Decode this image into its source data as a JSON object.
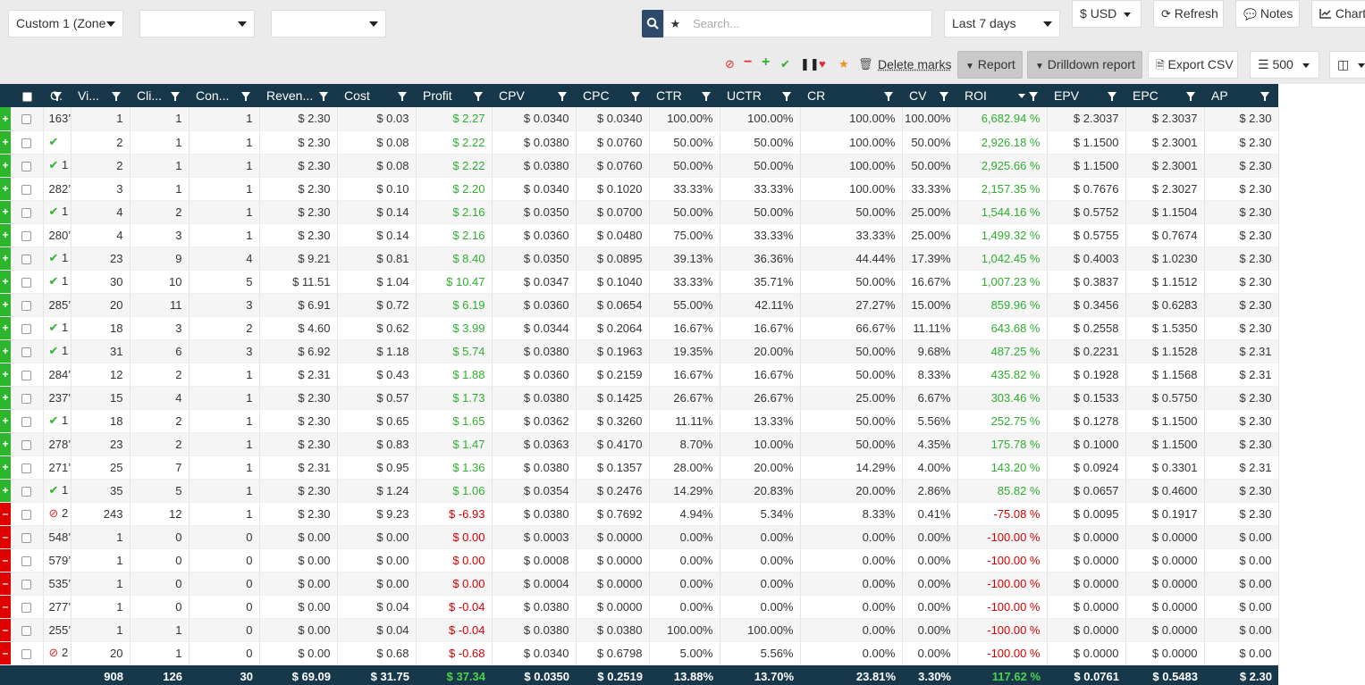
{
  "toolbar": {
    "group1": "Custom 1 (Zone",
    "group2": "",
    "group3": "",
    "search_placeholder": "Search...",
    "date_range": "Last 7 days",
    "currency": "USD",
    "refresh": "Refresh",
    "notes": "Notes",
    "chart": "Chart",
    "delete_marks": "Delete marks",
    "report": "Report",
    "drilldown": "Drilldown report",
    "export_csv": "Export CSV",
    "page_size": "500"
  },
  "columns": [
    "C.",
    "Vi...",
    "Cli...",
    "Con...",
    "Reven...",
    "Cost",
    "Profit",
    "CPV",
    "CPC",
    "CTR",
    "UCTR",
    "CR",
    "CV",
    "ROI",
    "EPV",
    "EPC",
    "AP"
  ],
  "rows": [
    {
      "mark": "+",
      "id": "163’",
      "ok": false,
      "ban": false,
      "v": [
        "1",
        "1",
        "1",
        "$ 2.30",
        "$ 0.03",
        "$ 2.27",
        "$ 0.0340",
        "$ 0.0340",
        "100.00%",
        "100.00%",
        "100.00%",
        "100.00%",
        "6,682.94 %",
        "$ 2.3037",
        "$ 2.3037",
        "$ 2.30"
      ]
    },
    {
      "mark": "+",
      "id": "",
      "ok": true,
      "ban": false,
      "v": [
        "2",
        "1",
        "1",
        "$ 2.30",
        "$ 0.08",
        "$ 2.22",
        "$ 0.0380",
        "$ 0.0760",
        "50.00%",
        "50.00%",
        "100.00%",
        "50.00%",
        "2,926.18 %",
        "$ 1.1500",
        "$ 2.3001",
        "$ 2.30"
      ]
    },
    {
      "mark": "+",
      "id": "1",
      "ok": true,
      "ban": false,
      "v": [
        "2",
        "1",
        "1",
        "$ 2.30",
        "$ 0.08",
        "$ 2.22",
        "$ 0.0380",
        "$ 0.0760",
        "50.00%",
        "50.00%",
        "100.00%",
        "50.00%",
        "2,925.66 %",
        "$ 1.1500",
        "$ 2.3001",
        "$ 2.30"
      ]
    },
    {
      "mark": "+",
      "id": "282’",
      "ok": false,
      "ban": false,
      "v": [
        "3",
        "1",
        "1",
        "$ 2.30",
        "$ 0.10",
        "$ 2.20",
        "$ 0.0340",
        "$ 0.1020",
        "33.33%",
        "33.33%",
        "100.00%",
        "33.33%",
        "2,157.35 %",
        "$ 0.7676",
        "$ 2.3027",
        "$ 2.30"
      ]
    },
    {
      "mark": "+",
      "id": "1",
      "ok": true,
      "ban": false,
      "v": [
        "4",
        "2",
        "1",
        "$ 2.30",
        "$ 0.14",
        "$ 2.16",
        "$ 0.0350",
        "$ 0.0700",
        "50.00%",
        "50.00%",
        "50.00%",
        "25.00%",
        "1,544.16 %",
        "$ 0.5752",
        "$ 1.1504",
        "$ 2.30"
      ]
    },
    {
      "mark": "+",
      "id": "280’",
      "ok": false,
      "ban": false,
      "v": [
        "4",
        "3",
        "1",
        "$ 2.30",
        "$ 0.14",
        "$ 2.16",
        "$ 0.0360",
        "$ 0.0480",
        "75.00%",
        "33.33%",
        "33.33%",
        "25.00%",
        "1,499.32 %",
        "$ 0.5755",
        "$ 0.7674",
        "$ 2.30"
      ]
    },
    {
      "mark": "+",
      "id": "1",
      "ok": true,
      "ban": false,
      "v": [
        "23",
        "9",
        "4",
        "$ 9.21",
        "$ 0.81",
        "$ 8.40",
        "$ 0.0350",
        "$ 0.0895",
        "39.13%",
        "36.36%",
        "44.44%",
        "17.39%",
        "1,042.45 %",
        "$ 0.4003",
        "$ 1.0230",
        "$ 2.30"
      ]
    },
    {
      "mark": "+",
      "id": "1",
      "ok": true,
      "ban": false,
      "v": [
        "30",
        "10",
        "5",
        "$ 11.51",
        "$ 1.04",
        "$ 10.47",
        "$ 0.0347",
        "$ 0.1040",
        "33.33%",
        "35.71%",
        "50.00%",
        "16.67%",
        "1,007.23 %",
        "$ 0.3837",
        "$ 1.1512",
        "$ 2.30"
      ]
    },
    {
      "mark": "+",
      "id": "285’",
      "ok": false,
      "ban": false,
      "v": [
        "20",
        "11",
        "3",
        "$ 6.91",
        "$ 0.72",
        "$ 6.19",
        "$ 0.0360",
        "$ 0.0654",
        "55.00%",
        "42.11%",
        "27.27%",
        "15.00%",
        "859.96 %",
        "$ 0.3456",
        "$ 0.6283",
        "$ 2.30"
      ]
    },
    {
      "mark": "+",
      "id": "1",
      "ok": true,
      "ban": false,
      "v": [
        "18",
        "3",
        "2",
        "$ 4.60",
        "$ 0.62",
        "$ 3.99",
        "$ 0.0344",
        "$ 0.2064",
        "16.67%",
        "16.67%",
        "66.67%",
        "11.11%",
        "643.68 %",
        "$ 0.2558",
        "$ 1.5350",
        "$ 2.30"
      ]
    },
    {
      "mark": "+",
      "id": "1",
      "ok": true,
      "ban": false,
      "v": [
        "31",
        "6",
        "3",
        "$ 6.92",
        "$ 1.18",
        "$ 5.74",
        "$ 0.0380",
        "$ 0.1963",
        "19.35%",
        "20.00%",
        "50.00%",
        "9.68%",
        "487.25 %",
        "$ 0.2231",
        "$ 1.1528",
        "$ 2.31"
      ]
    },
    {
      "mark": "+",
      "id": "284’",
      "ok": false,
      "ban": false,
      "v": [
        "12",
        "2",
        "1",
        "$ 2.31",
        "$ 0.43",
        "$ 1.88",
        "$ 0.0360",
        "$ 0.2159",
        "16.67%",
        "16.67%",
        "50.00%",
        "8.33%",
        "435.82 %",
        "$ 0.1928",
        "$ 1.1568",
        "$ 2.31"
      ]
    },
    {
      "mark": "+",
      "id": "237’",
      "ok": false,
      "ban": false,
      "v": [
        "15",
        "4",
        "1",
        "$ 2.30",
        "$ 0.57",
        "$ 1.73",
        "$ 0.0380",
        "$ 0.1425",
        "26.67%",
        "26.67%",
        "25.00%",
        "6.67%",
        "303.46 %",
        "$ 0.1533",
        "$ 0.5750",
        "$ 2.30"
      ]
    },
    {
      "mark": "+",
      "id": "1",
      "ok": true,
      "ban": false,
      "v": [
        "18",
        "2",
        "1",
        "$ 2.30",
        "$ 0.65",
        "$ 1.65",
        "$ 0.0362",
        "$ 0.3260",
        "11.11%",
        "13.33%",
        "50.00%",
        "5.56%",
        "252.75 %",
        "$ 0.1278",
        "$ 1.1500",
        "$ 2.30"
      ]
    },
    {
      "mark": "+",
      "id": "278’",
      "ok": false,
      "ban": false,
      "v": [
        "23",
        "2",
        "1",
        "$ 2.30",
        "$ 0.83",
        "$ 1.47",
        "$ 0.0363",
        "$ 0.4170",
        "8.70%",
        "10.00%",
        "50.00%",
        "4.35%",
        "175.78 %",
        "$ 0.1000",
        "$ 1.1500",
        "$ 2.30"
      ]
    },
    {
      "mark": "+",
      "id": "271’",
      "ok": false,
      "ban": false,
      "v": [
        "25",
        "7",
        "1",
        "$ 2.31",
        "$ 0.95",
        "$ 1.36",
        "$ 0.0380",
        "$ 0.1357",
        "28.00%",
        "20.00%",
        "14.29%",
        "4.00%",
        "143.20 %",
        "$ 0.0924",
        "$ 0.3301",
        "$ 2.31"
      ]
    },
    {
      "mark": "+",
      "id": "1",
      "ok": true,
      "ban": false,
      "v": [
        "35",
        "5",
        "1",
        "$ 2.30",
        "$ 1.24",
        "$ 1.06",
        "$ 0.0354",
        "$ 0.2476",
        "14.29%",
        "20.83%",
        "20.00%",
        "2.86%",
        "85.82 %",
        "$ 0.0657",
        "$ 0.4600",
        "$ 2.30"
      ]
    },
    {
      "mark": "–",
      "id": "2",
      "ok": false,
      "ban": true,
      "v": [
        "243",
        "12",
        "1",
        "$ 2.30",
        "$ 9.23",
        "$ -6.93",
        "$ 0.0380",
        "$ 0.7692",
        "4.94%",
        "5.34%",
        "8.33%",
        "0.41%",
        "-75.08 %",
        "$ 0.0095",
        "$ 0.1917",
        "$ 2.30"
      ]
    },
    {
      "mark": "–",
      "id": "548’",
      "ok": false,
      "ban": false,
      "v": [
        "1",
        "0",
        "0",
        "$ 0.00",
        "$ 0.00",
        "$ 0.00",
        "$ 0.0003",
        "$ 0.0000",
        "0.00%",
        "0.00%",
        "0.00%",
        "0.00%",
        "-100.00 %",
        "$ 0.0000",
        "$ 0.0000",
        "$ 0.00"
      ]
    },
    {
      "mark": "–",
      "id": "579’",
      "ok": false,
      "ban": false,
      "v": [
        "1",
        "0",
        "0",
        "$ 0.00",
        "$ 0.00",
        "$ 0.00",
        "$ 0.0008",
        "$ 0.0000",
        "0.00%",
        "0.00%",
        "0.00%",
        "0.00%",
        "-100.00 %",
        "$ 0.0000",
        "$ 0.0000",
        "$ 0.00"
      ]
    },
    {
      "mark": "–",
      "id": "535’",
      "ok": false,
      "ban": false,
      "v": [
        "1",
        "0",
        "0",
        "$ 0.00",
        "$ 0.00",
        "$ 0.00",
        "$ 0.0004",
        "$ 0.0000",
        "0.00%",
        "0.00%",
        "0.00%",
        "0.00%",
        "-100.00 %",
        "$ 0.0000",
        "$ 0.0000",
        "$ 0.00"
      ]
    },
    {
      "mark": "–",
      "id": "277’",
      "ok": false,
      "ban": false,
      "v": [
        "1",
        "0",
        "0",
        "$ 0.00",
        "$ 0.04",
        "$ -0.04",
        "$ 0.0380",
        "$ 0.0000",
        "0.00%",
        "0.00%",
        "0.00%",
        "0.00%",
        "-100.00 %",
        "$ 0.0000",
        "$ 0.0000",
        "$ 0.00"
      ]
    },
    {
      "mark": "–",
      "id": "255’",
      "ok": false,
      "ban": false,
      "v": [
        "1",
        "1",
        "0",
        "$ 0.00",
        "$ 0.04",
        "$ -0.04",
        "$ 0.0380",
        "$ 0.0380",
        "100.00%",
        "100.00%",
        "0.00%",
        "0.00%",
        "-100.00 %",
        "$ 0.0000",
        "$ 0.0000",
        "$ 0.00"
      ]
    },
    {
      "mark": "–",
      "id": "2",
      "ok": false,
      "ban": true,
      "v": [
        "20",
        "1",
        "0",
        "$ 0.00",
        "$ 0.68",
        "$ -0.68",
        "$ 0.0340",
        "$ 0.6798",
        "5.00%",
        "5.56%",
        "0.00%",
        "0.00%",
        "-100.00 %",
        "$ 0.0000",
        "$ 0.0000",
        "$ 0.00"
      ]
    }
  ],
  "totals": [
    "908",
    "126",
    "30",
    "$ 69.09",
    "$ 31.75",
    "$ 37.34",
    "$ 0.0350",
    "$ 0.2519",
    "13.88%",
    "13.70%",
    "23.81%",
    "3.30%",
    "117.62 %",
    "$ 0.0761",
    "$ 0.5483",
    "$ 2.30"
  ],
  "colors": {
    "header_bg": "#17384a",
    "positive": "#2fae2f",
    "negative": "#d40000",
    "mark_green": "#2db52d",
    "mark_red": "#e00000"
  }
}
